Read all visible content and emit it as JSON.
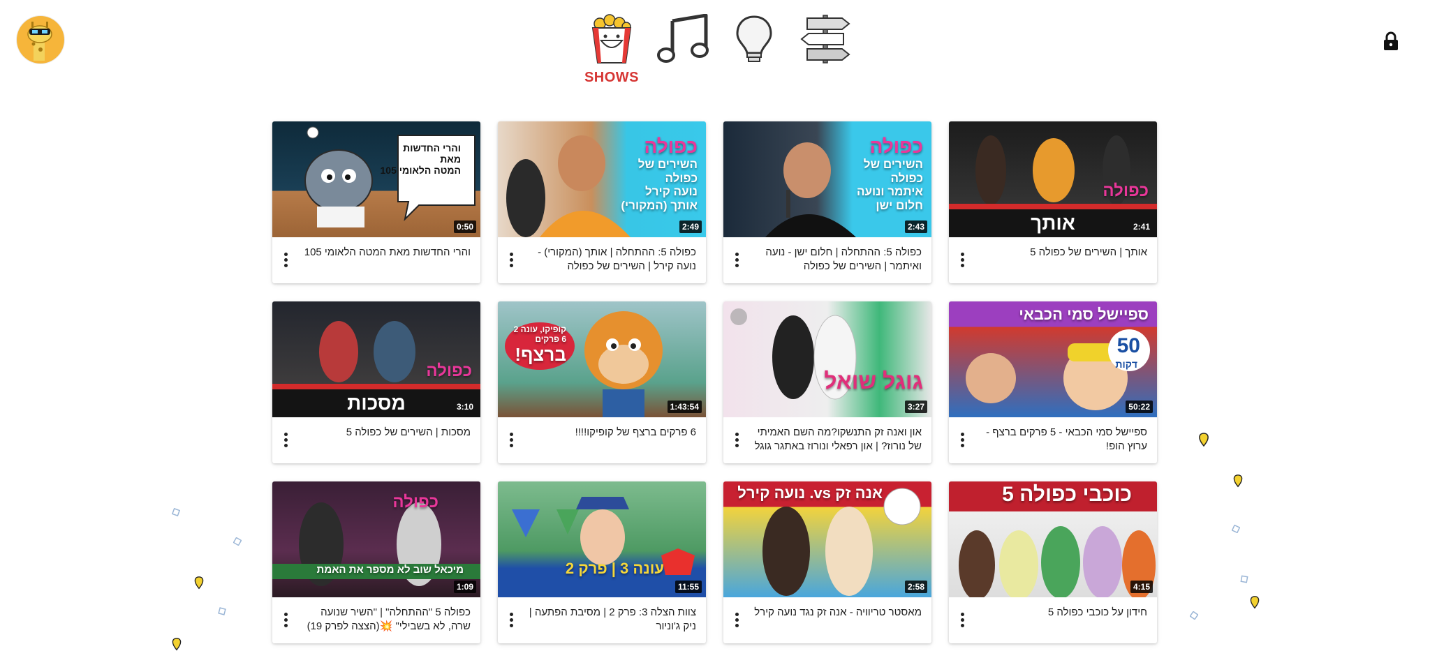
{
  "header": {
    "avatar_icon": "giraffe-avatar-icon",
    "lock_icon": "lock-icon",
    "categories": [
      {
        "id": "shows",
        "label": "SHOWS",
        "icon": "popcorn-icon",
        "selected": true
      },
      {
        "id": "music",
        "label": "",
        "icon": "music-notes-icon",
        "selected": false
      },
      {
        "id": "learning",
        "label": "",
        "icon": "lightbulb-icon",
        "selected": false
      },
      {
        "id": "explore",
        "label": "",
        "icon": "signpost-icon",
        "selected": false
      }
    ]
  },
  "colors": {
    "accent": "#d63533",
    "card_shadow": "#00000022"
  },
  "videos": [
    {
      "title": "והרי החדשות מאת המטה הלאומי 105",
      "duration": "0:50",
      "overlay": [
        "והרי החדשות",
        "מאת",
        "המטה הלאומי 105"
      ],
      "bar": ""
    },
    {
      "title": "כפולה 5: ההתחלה | אותך (המקורי) - נועה קירל | השירים של כפולה",
      "duration": "2:49",
      "overlay": [
        "כפולה",
        "השירים של",
        "כפולה",
        "נועה קירל",
        "אותך (המקורי)"
      ],
      "bar": ""
    },
    {
      "title": "כפולה 5: ההתחלה | חלום ישן - נועה ואיתמר | השירים של כפולה",
      "duration": "2:43",
      "overlay": [
        "כפולה",
        "השירים של",
        "כפולה",
        "איתמר ונועה",
        "חלום ישן"
      ],
      "bar": ""
    },
    {
      "title": "אותך | השירים של כפולה 5",
      "duration": "2:41",
      "overlay": [
        "כפולה"
      ],
      "bar": "אותך"
    },
    {
      "title": "מסכות | השירים של כפולה 5",
      "duration": "3:10",
      "overlay": [
        "כפולה"
      ],
      "bar": "מסכות"
    },
    {
      "title": "6 פרקים ברצף של קופיקו!!!!",
      "duration": "1:43:54",
      "overlay": [
        "קופיקו, עונה 2",
        "6 פרקים",
        "ברצף!"
      ],
      "bar": ""
    },
    {
      "title": "און ואנה זק התנשקו?מה השם האמיתי של נורוז? | און רפאלי ונורוז באתגר גוגל",
      "duration": "3:27",
      "overlay": [
        "גוגל שואל"
      ],
      "bar": ""
    },
    {
      "title": "ספיישל סמי הכבאי - 5 פרקים ברצף - ערוץ הופ!",
      "duration": "50:22",
      "overlay": [
        "ספיישל סמי הכבאי",
        "50",
        "דקות"
      ],
      "bar": ""
    },
    {
      "title": "כפולה 5 \"ההתחלה\" | \"השיר שנועה שרה, לא בשבילי\" 💥(הצצה לפרק 19)",
      "duration": "1:09",
      "overlay": [
        "כפולה",
        "מיכאל שוב לא מספר את האמת"
      ],
      "bar": ""
    },
    {
      "title": "צוות הצלה 3: פרק 2 | מסיבת הפתעה | ניק ג'וניור",
      "duration": "11:55",
      "overlay": [
        "עונה 3 | פרק 2"
      ],
      "bar": ""
    },
    {
      "title": "מאסטר טריוויה - אנה זק נגד נועה קירל",
      "duration": "2:58",
      "overlay": [
        "אנה זק vs. נועה קירל"
      ],
      "bar": ""
    },
    {
      "title": "חידון על כוכבי כפולה 5",
      "duration": "4:15",
      "overlay": [
        "כוכבי כפולה 5"
      ],
      "bar": ""
    }
  ]
}
